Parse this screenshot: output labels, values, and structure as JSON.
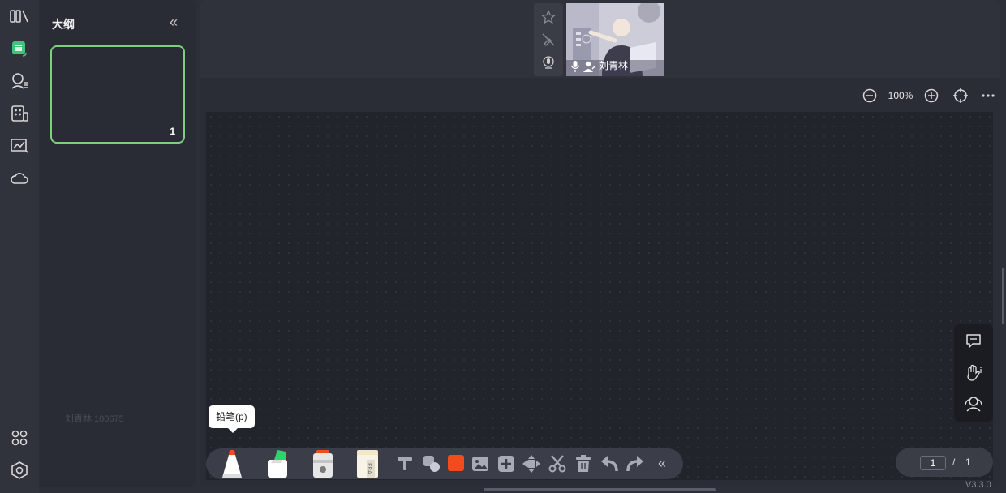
{
  "outline": {
    "title": "大纲",
    "collapse_glyph": "«",
    "page_number": "1",
    "watermark": "刘青林 100675"
  },
  "video": {
    "participant_name": "刘青林"
  },
  "zoom": {
    "level": "100%"
  },
  "tooltip": {
    "text": "铅笔(p)"
  },
  "toolbar": {
    "collapse_glyph": "«",
    "accent_color": "#f24b1c"
  },
  "pager": {
    "current": "1",
    "separator": "/",
    "total": "1"
  },
  "version": "V3.3.0",
  "colors": {
    "accent_green": "#7ed07e",
    "red": "#f24b1c"
  }
}
